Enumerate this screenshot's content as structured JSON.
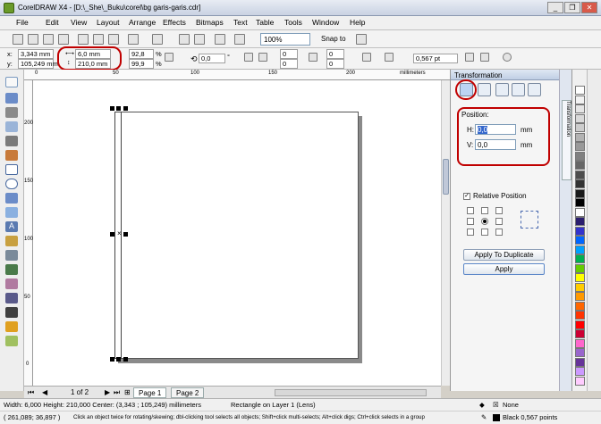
{
  "window": {
    "title": "CorelDRAW X4 - [D:\\_She\\_Buku\\corel\\bg garis-garis.cdr]",
    "minimize": "_",
    "restore": "❐",
    "close": "✕"
  },
  "menu": {
    "items": [
      "File",
      "Edit",
      "View",
      "Layout",
      "Arrange",
      "Effects",
      "Bitmaps",
      "Text",
      "Table",
      "Tools",
      "Window",
      "Help"
    ]
  },
  "toolbar": {
    "zoom": "100%",
    "snap_to": "Snap to"
  },
  "propbar": {
    "x_label": "x:",
    "x": "3,343 mm",
    "y_label": "y:",
    "y": "105,249 mm",
    "w": "6,0 mm",
    "h": "210,0 mm",
    "scale_w": "92,8",
    "scale_h": "99,9",
    "pct": "%",
    "angle": "0,0",
    "deg": "°",
    "corner1": "0",
    "corner2": "0",
    "corner3": "0",
    "corner4": "0",
    "outline": "0,567 pt"
  },
  "ruler": {
    "unit": "millimeters",
    "h_ticks": [
      "0",
      "50",
      "100",
      "150",
      "200",
      "250"
    ],
    "v_ticks": [
      "200",
      "150",
      "100",
      "50",
      "0"
    ]
  },
  "docker": {
    "title": "Transformation",
    "position_label": "Position:",
    "h_label": "H:",
    "h_value": "0,0",
    "h_unit": "mm",
    "v_label": "V:",
    "v_value": "0,0",
    "v_unit": "mm",
    "relative_label": "Relative Position",
    "apply_duplicate": "Apply To Duplicate",
    "apply": "Apply",
    "side_tab": "Transformation"
  },
  "pages": {
    "nav": "1 of 2",
    "tabs": [
      "Page 1",
      "Page 2"
    ]
  },
  "status": {
    "dims": "Width: 6,000  Height: 210,000  Center: (3,343 ; 105,249)  millimeters",
    "object": "Rectangle on Layer 1  (Lens)",
    "fill": "None",
    "coords": "( 261,089; 36,897 )",
    "hint": "Click an object twice for rotating/skewing; dbl-clicking tool selects all objects; Shift+click multi-selects; Alt+click digs; Ctrl+click selects in a group",
    "outline": "Black  0,567 points"
  },
  "palette": {
    "colors": [
      "#ffffff",
      "#f2f2f2",
      "#e5e5e5",
      "#d9d9d9",
      "#cccccc",
      "#b3b3b3",
      "#999999",
      "#808080",
      "#666666",
      "#4d4d4d",
      "#333333",
      "#1a1a1a",
      "#000000",
      "#ffffff",
      "#2b1e6e",
      "#3333cc",
      "#0066ff",
      "#00a0ff",
      "#00b050",
      "#66cc00",
      "#ffff00",
      "#ffcc00",
      "#ff9900",
      "#ff6600",
      "#ff3300",
      "#ff0000",
      "#cc0033",
      "#ff66cc",
      "#9966cc",
      "#663399",
      "#cc99ff",
      "#ffccff"
    ]
  }
}
